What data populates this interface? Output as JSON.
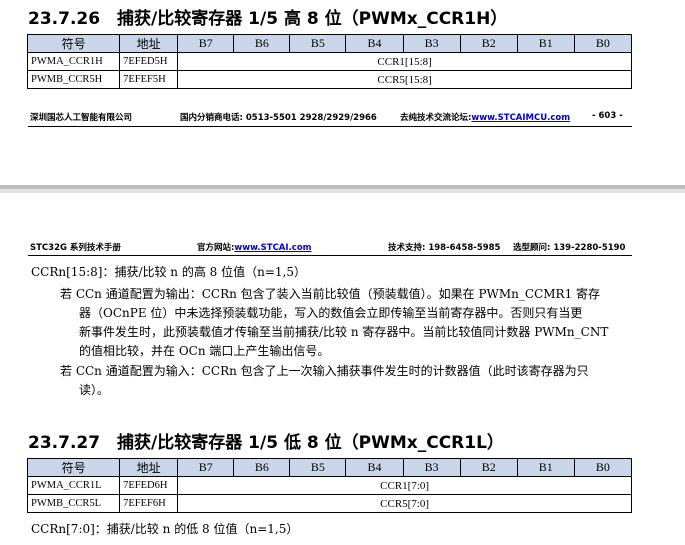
{
  "section1": {
    "title": "23.7.26　捕获/比较寄存器 1/5 高 8 位（PWMx_CCR1H）",
    "headers": [
      "符号",
      "地址",
      "B7",
      "B6",
      "B5",
      "B4",
      "B3",
      "B2",
      "B1",
      "B0"
    ],
    "rows": [
      {
        "name": "PWMA_CCR1H",
        "addr": "7EFED5H",
        "value": "CCR1[15:8]"
      },
      {
        "name": "PWMB_CCR5H",
        "addr": "7EFEF5H",
        "value": "CCR5[15:8]"
      }
    ]
  },
  "footer": {
    "company": "深圳国芯人工智能有限公司",
    "phone": "国内分销商电话: 0513-5501 2928/2929/2966",
    "forum_label": "去纯技术交流论坛:",
    "forum_url": "www.STCAIMCU.com",
    "page": "- 603 -"
  },
  "header": {
    "manual": "STC32G 系列技术手册",
    "site_label": "官方网站:",
    "site_url": "www.STCAI.com",
    "support": "技术支持: 198-6458-5985",
    "consult": "选型顾问: 139-2280-5190"
  },
  "description": {
    "heading": "CCRn[15:8]：捕获/比较 n 的高 8 位值（n=1,5）",
    "para1_l1": "若 CCn 通道配置为输出：CCRn 包含了装入当前比较值（预装载值）。如果在 PWMn_CCMR1 寄存",
    "para1_l2": "器（OCnPE 位）中未选择预装载功能，写入的数值会立即传输至当前寄存器中。否则只有当更",
    "para1_l3": "新事件发生时，此预装载值才传输至当前捕获/比较 n 寄存器中。当前比较值同计数器 PWMn_CNT",
    "para1_l4": "的值相比较，并在 OCn 端口上产生输出信号。",
    "para2_l1": "若 CCn 通道配置为输入：CCRn 包含了上一次输入捕获事件发生时的计数器值（此时该寄存器为只",
    "para2_l2": "读）。"
  },
  "section2": {
    "title": "23.7.27　捕获/比较寄存器 1/5 低 8 位（PWMx_CCR1L）",
    "headers": [
      "符号",
      "地址",
      "B7",
      "B6",
      "B5",
      "B4",
      "B3",
      "B2",
      "B1",
      "B0"
    ],
    "rows": [
      {
        "name": "PWMA_CCR1L",
        "addr": "7EFED6H",
        "value": "CCR1[7:0]"
      },
      {
        "name": "PWMB_CCR5L",
        "addr": "7EFEF6H",
        "value": "CCR5[7:0]"
      }
    ],
    "note": "CCRn[7:0]：捕获/比较 n 的低 8 位值（n=1,5）"
  }
}
